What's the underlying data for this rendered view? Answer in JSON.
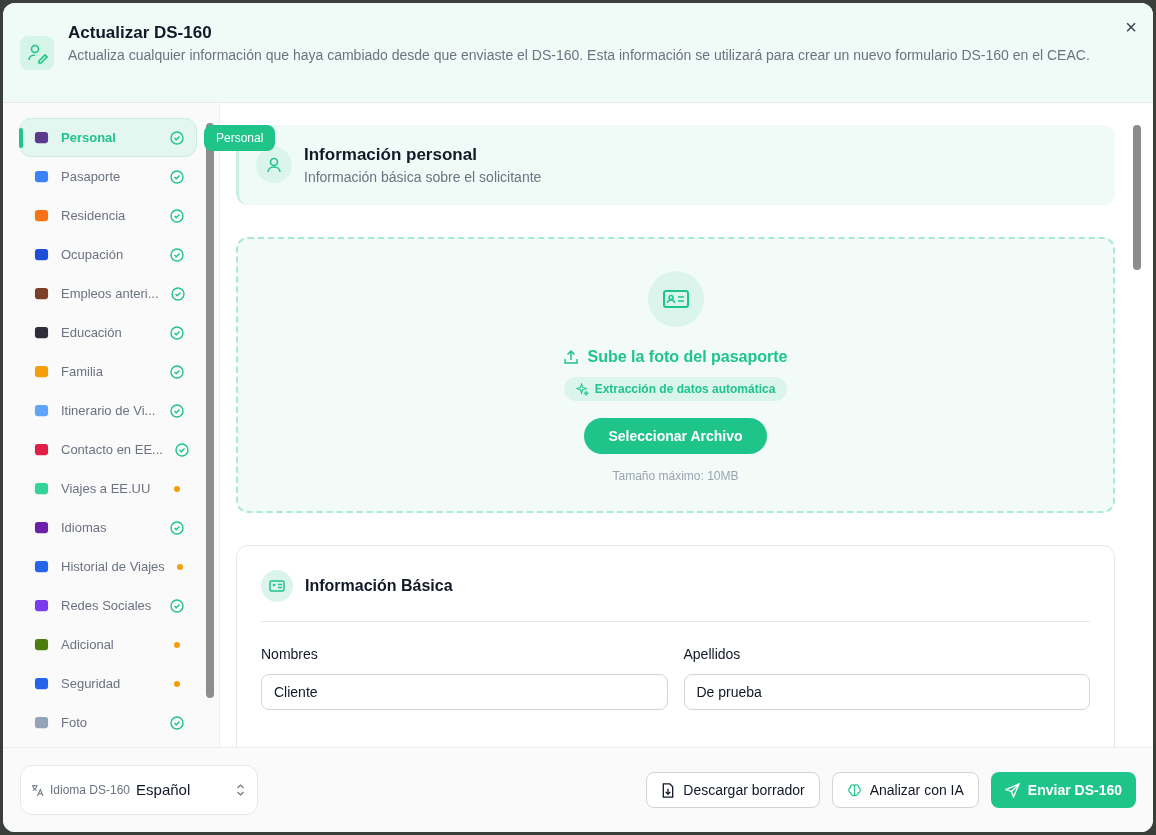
{
  "dialog": {
    "title": "Actualizar DS-160",
    "description": "Actualiza cualquier información que haya cambiado desde que enviaste el DS-160. Esta información se utilizará para crear un nuevo formulario DS-160 en el CEAC.",
    "close": "×"
  },
  "sidebar": {
    "items": [
      {
        "label": "Personal",
        "completed": true,
        "selected": true
      },
      {
        "label": "Pasaporte",
        "completed": true,
        "selected": false
      },
      {
        "label": "Residencia",
        "completed": true,
        "selected": false
      },
      {
        "label": "Ocupación",
        "completed": true,
        "selected": false
      },
      {
        "label": "Empleos anteri...",
        "completed": true,
        "selected": false
      },
      {
        "label": "Educación",
        "completed": true,
        "selected": false
      },
      {
        "label": "Familia",
        "completed": true,
        "selected": false
      },
      {
        "label": "Itinerario de Vi...",
        "completed": true,
        "selected": false
      },
      {
        "label": "Contacto en EE...",
        "completed": true,
        "selected": false
      },
      {
        "label": "Viajes a EE.UU",
        "completed": false,
        "selected": false
      },
      {
        "label": "Idiomas",
        "completed": true,
        "selected": false
      },
      {
        "label": "Historial de Viajes",
        "completed": false,
        "selected": false
      },
      {
        "label": "Redes Sociales",
        "completed": true,
        "selected": false
      },
      {
        "label": "Adicional",
        "completed": false,
        "selected": false
      },
      {
        "label": "Seguridad",
        "completed": false,
        "selected": false
      },
      {
        "label": "Foto",
        "completed": true,
        "selected": false
      }
    ],
    "tooltip": "Personal"
  },
  "section": {
    "title": "Información personal",
    "subtitle": "Información básica sobre el solicitante"
  },
  "upload": {
    "title": "Sube la foto del pasaporte",
    "badge": "Extracción de datos automática",
    "button": "Seleccionar Archivo",
    "hint": "Tamaño máximo: 10MB"
  },
  "card": {
    "title": "Información Básica",
    "fields": [
      {
        "label": "Nombres",
        "value": "Cliente"
      },
      {
        "label": "Apellidos",
        "value": "De prueba"
      }
    ]
  },
  "footer": {
    "language_label": "Idioma DS-160",
    "language": "Español",
    "buttons": [
      {
        "label": "Descargar borrador",
        "kind": "download"
      },
      {
        "label": "Analizar con IA",
        "kind": "ai"
      },
      {
        "label": "Enviar DS-160",
        "kind": "send"
      }
    ]
  }
}
